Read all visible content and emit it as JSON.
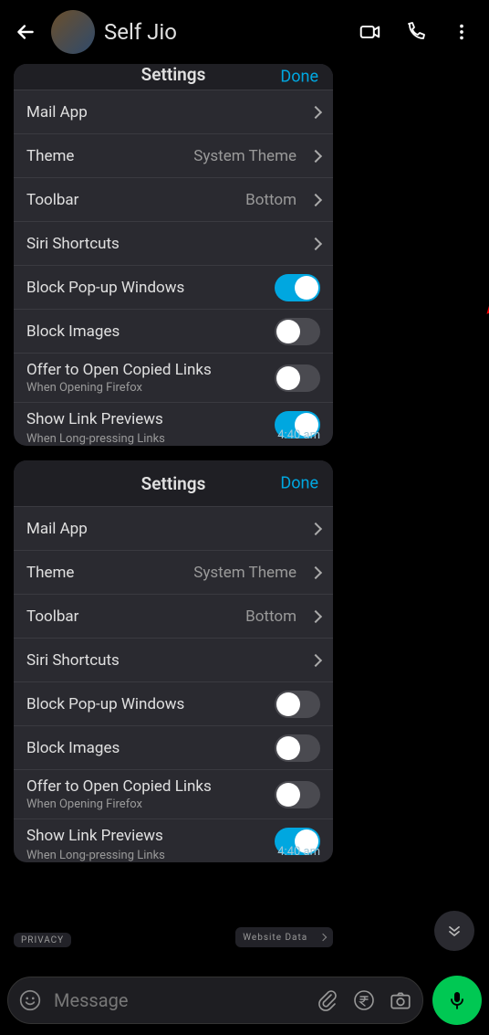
{
  "header": {
    "chat_title": "Self Jio"
  },
  "bubbles": [
    {
      "header_title": "Settings",
      "done_label": "Done",
      "header_partial": true,
      "timestamp": "4:40 am",
      "rows": [
        {
          "label": "Mail App",
          "value": "",
          "type": "nav"
        },
        {
          "label": "Theme",
          "value": "System Theme",
          "type": "nav"
        },
        {
          "label": "Toolbar",
          "value": "Bottom",
          "type": "nav"
        },
        {
          "label": "Siri Shortcuts",
          "value": "",
          "type": "nav"
        },
        {
          "label": "Block Pop-up Windows",
          "type": "toggle",
          "on": true
        },
        {
          "label": "Block Images",
          "type": "toggle",
          "on": false
        },
        {
          "label": "Offer to Open Copied Links",
          "sub": "When Opening Firefox",
          "type": "toggle",
          "on": false
        },
        {
          "label": "Show Link Previews",
          "sub": "When Long-pressing Links",
          "type": "toggle",
          "on": true,
          "last": true
        }
      ]
    },
    {
      "header_title": "Settings",
      "done_label": "Done",
      "header_partial": false,
      "timestamp": "4:40 am",
      "rows": [
        {
          "label": "Mail App",
          "value": "",
          "type": "nav"
        },
        {
          "label": "Theme",
          "value": "System Theme",
          "type": "nav"
        },
        {
          "label": "Toolbar",
          "value": "Bottom",
          "type": "nav"
        },
        {
          "label": "Siri Shortcuts",
          "value": "",
          "type": "nav"
        },
        {
          "label": "Block Pop-up Windows",
          "type": "toggle",
          "on": false
        },
        {
          "label": "Block Images",
          "type": "toggle",
          "on": false
        },
        {
          "label": "Offer to Open Copied Links",
          "sub": "When Opening Firefox",
          "type": "toggle",
          "on": false
        },
        {
          "label": "Show Link Previews",
          "sub": "When Long-pressing Links",
          "type": "toggle",
          "on": true,
          "last": true
        }
      ]
    }
  ],
  "fragment": {
    "left_label": "PRIVACY",
    "right_label": "Website Data"
  },
  "input": {
    "placeholder": "Message"
  }
}
